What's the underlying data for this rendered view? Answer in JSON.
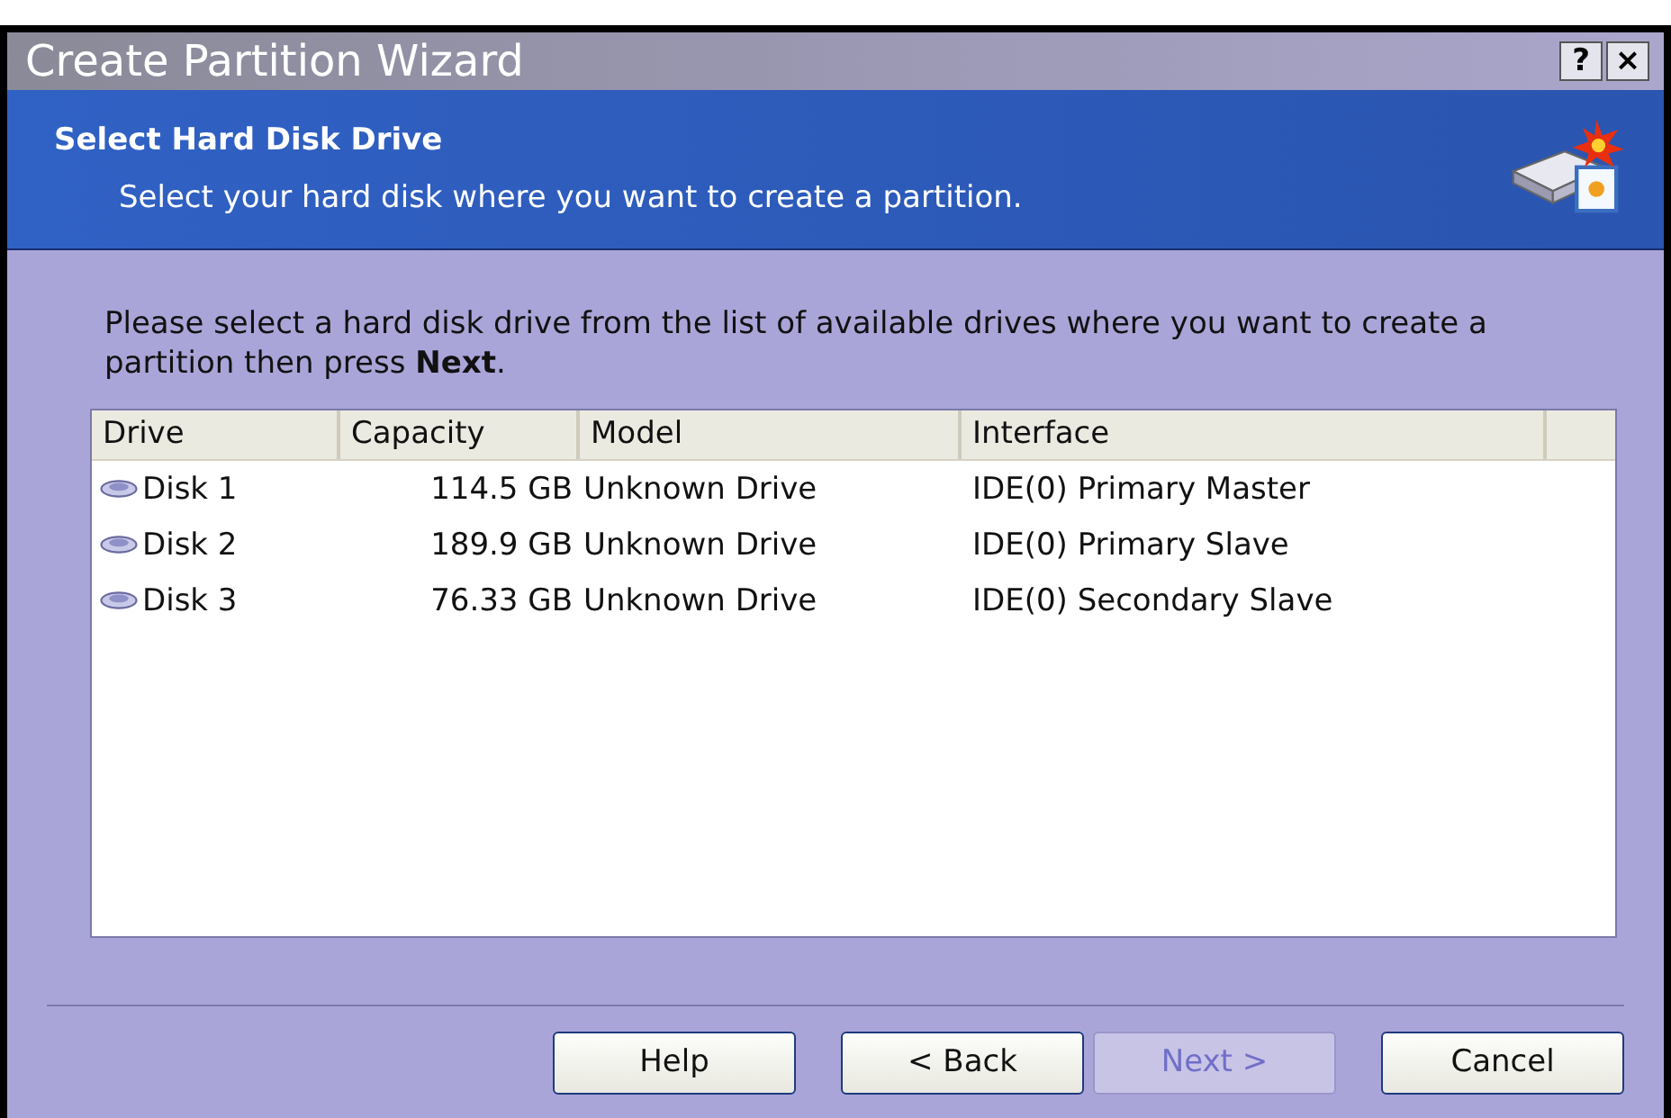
{
  "window": {
    "title": "Create Partition Wizard",
    "buttons": [
      "?",
      "×"
    ]
  },
  "header": {
    "title": "Select Hard Disk Drive",
    "subtitle": "Select your hard disk where you want to create a partition."
  },
  "instruction": "Please select a hard disk drive from the list of available drives where you want to create a partition then press **Next**.",
  "table": {
    "columns": [
      "Drive",
      "Capacity",
      "Model",
      "Interface"
    ],
    "rows": [
      {
        "drive": "Disk 1",
        "capacity": "114.5 GB",
        "model": "Unknown Drive",
        "interface": "IDE(0) Primary Master"
      },
      {
        "drive": "Disk 2",
        "capacity": "189.9 GB",
        "model": "Unknown Drive",
        "interface": "IDE(0) Primary Slave"
      },
      {
        "drive": "Disk 3",
        "capacity": "76.33 GB",
        "model": "Unknown Drive",
        "interface": "IDE(0) Secondary Slave"
      }
    ]
  },
  "buttons": [
    {
      "label": "Help",
      "disabled": false
    },
    {
      "label": "< Back",
      "disabled": false
    },
    {
      "label": "Next >",
      "disabled": true
    },
    {
      "label": "Cancel",
      "disabled": false
    }
  ]
}
